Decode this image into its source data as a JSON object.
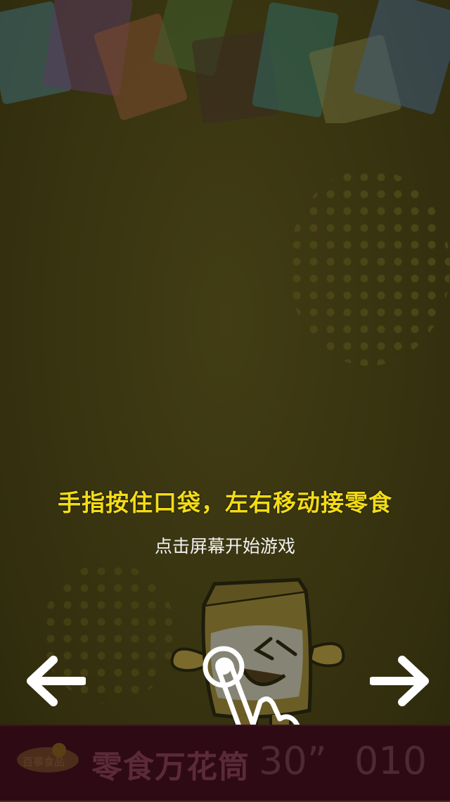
{
  "instruction": {
    "main": "手指按住口袋，左右移动接零食",
    "sub": "点击屏幕开始游戏"
  },
  "controls": {
    "left_arrow_icon": "arrow-left-icon",
    "right_arrow_icon": "arrow-right-icon"
  },
  "bottom_bar": {
    "brand": "百事食品",
    "game_title": "零食万花筒",
    "timer": "30”",
    "score": "010"
  },
  "colors": {
    "instruction": "#f3dc16",
    "sub": "#f1f1f1",
    "background": "#3b3612",
    "bottom_bar": "#2e0a14"
  }
}
